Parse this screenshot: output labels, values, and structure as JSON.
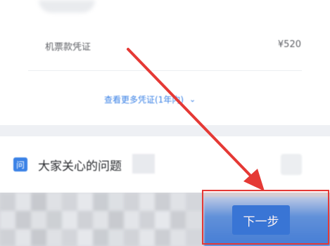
{
  "voucher_row": {
    "label": "机票款凭证",
    "amount": "¥520"
  },
  "more_link": {
    "label": "查看更多凭证(1年内)",
    "chevron": "chevron-down-icon"
  },
  "faq": {
    "icon_glyph": "问",
    "title": "大家关心的问题"
  },
  "footer": {
    "next_label": "下一步"
  },
  "colors": {
    "accent": "#3b82e6",
    "annotation": "#e53935"
  }
}
